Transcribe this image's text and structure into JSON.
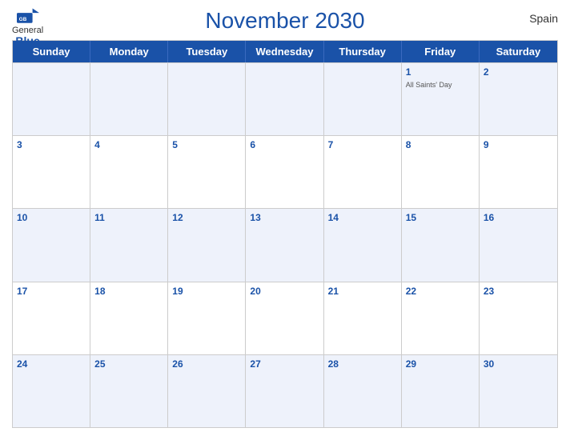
{
  "header": {
    "title": "November 2030",
    "country": "Spain",
    "logo_general": "General",
    "logo_blue": "Blue"
  },
  "days_of_week": [
    "Sunday",
    "Monday",
    "Tuesday",
    "Wednesday",
    "Thursday",
    "Friday",
    "Saturday"
  ],
  "weeks": [
    [
      {
        "day": "",
        "empty": true
      },
      {
        "day": "",
        "empty": true
      },
      {
        "day": "",
        "empty": true
      },
      {
        "day": "",
        "empty": true
      },
      {
        "day": "",
        "empty": true
      },
      {
        "day": "1",
        "events": [
          "All Saints' Day"
        ]
      },
      {
        "day": "2",
        "events": []
      }
    ],
    [
      {
        "day": "3",
        "events": []
      },
      {
        "day": "4",
        "events": []
      },
      {
        "day": "5",
        "events": []
      },
      {
        "day": "6",
        "events": []
      },
      {
        "day": "7",
        "events": []
      },
      {
        "day": "8",
        "events": []
      },
      {
        "day": "9",
        "events": []
      }
    ],
    [
      {
        "day": "10",
        "events": []
      },
      {
        "day": "11",
        "events": []
      },
      {
        "day": "12",
        "events": []
      },
      {
        "day": "13",
        "events": []
      },
      {
        "day": "14",
        "events": []
      },
      {
        "day": "15",
        "events": []
      },
      {
        "day": "16",
        "events": []
      }
    ],
    [
      {
        "day": "17",
        "events": []
      },
      {
        "day": "18",
        "events": []
      },
      {
        "day": "19",
        "events": []
      },
      {
        "day": "20",
        "events": []
      },
      {
        "day": "21",
        "events": []
      },
      {
        "day": "22",
        "events": []
      },
      {
        "day": "23",
        "events": []
      }
    ],
    [
      {
        "day": "24",
        "events": []
      },
      {
        "day": "25",
        "events": []
      },
      {
        "day": "26",
        "events": []
      },
      {
        "day": "27",
        "events": []
      },
      {
        "day": "28",
        "events": []
      },
      {
        "day": "29",
        "events": []
      },
      {
        "day": "30",
        "events": []
      }
    ]
  ]
}
